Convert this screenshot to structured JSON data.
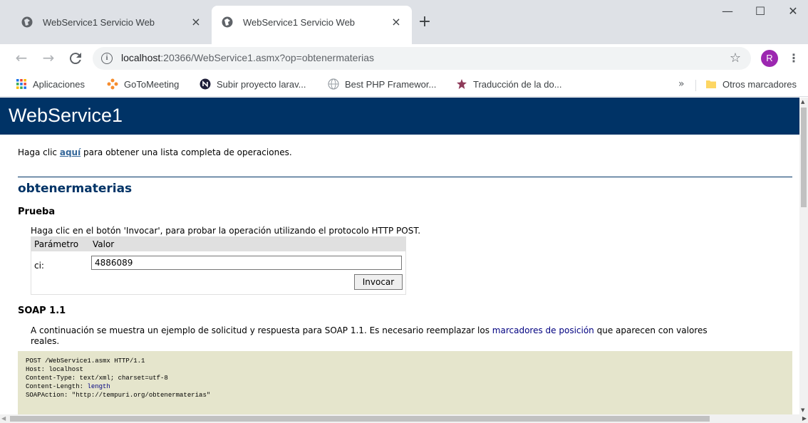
{
  "browser": {
    "tabs": [
      {
        "title": "WebService1 Servicio Web",
        "active": false,
        "close": "×"
      },
      {
        "title": "WebService1 Servicio Web",
        "active": true,
        "close": "×"
      }
    ],
    "new_tab": "+",
    "window_controls": {
      "minimize": "—",
      "maximize": "☐",
      "close": "✕"
    },
    "nav": {
      "back": "←",
      "forward": "→",
      "reload": "C"
    },
    "address": {
      "host": "localhost",
      "path": ":20366/WebService1.asmx?op=obtenermaterias",
      "info": "i"
    },
    "star": "☆",
    "avatar": "R",
    "menu": "⋮",
    "bookmarks": [
      {
        "label": "Aplicaciones",
        "icon": "apps-grid-icon"
      },
      {
        "label": "GoToMeeting",
        "icon": "gotomeeting-icon"
      },
      {
        "label": "Subir proyecto larav...",
        "icon": "n-logo-icon"
      },
      {
        "label": "Best PHP Framewor...",
        "icon": "globe-icon"
      },
      {
        "label": "Traducción de la do...",
        "icon": "star-logo-icon"
      }
    ],
    "bookmarks_more": "»",
    "other_bookmarks": "Otros marcadores"
  },
  "page": {
    "service_name": "WebService1",
    "intro_before": "Haga clic ",
    "intro_link": "aquí",
    "intro_after": " para obtener una lista completa de operaciones.",
    "operation": "obtenermaterias",
    "test_title": "Prueba",
    "test_desc": "Haga clic en el botón 'Invocar', para probar la operación utilizando el protocolo HTTP POST.",
    "param_header": "Parámetro",
    "value_header": "Valor",
    "param_name": "ci:",
    "param_value": "4886089",
    "invoke_label": "Invocar",
    "soap_title": "SOAP 1.1",
    "soap_desc_before": "A continuación se muestra un ejemplo de solicitud y respuesta para SOAP 1.1. Es necesario reemplazar los ",
    "soap_desc_link": "marcadores de posición",
    "soap_desc_after": " que aparecen con valores",
    "soap_desc_line2": "reales.",
    "code": {
      "line1": "POST /WebService1.asmx HTTP/1.1",
      "line2": "Host: localhost",
      "line3": "Content-Type: text/xml; charset=utf-8",
      "line4_label": "Content-Length: ",
      "line4_placeholder": "length",
      "line5": "SOAPAction: \"http://tempuri.org/obtenermaterias\""
    }
  },
  "colors": {
    "header_bg": "#003366",
    "code_bg": "#e5e5cc",
    "link": "#336699",
    "placeholder": "#000080"
  }
}
